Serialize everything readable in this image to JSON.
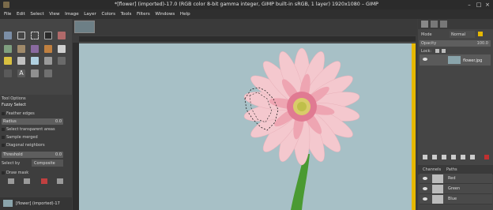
{
  "window": {
    "title": "*[flower] (imported)-17.0 (RGB color 8-bit gamma integer, GIMP built-in sRGB, 1 layer) 1920x1080 – GIMP"
  },
  "menu": [
    "File",
    "Edit",
    "Select",
    "View",
    "Image",
    "Layer",
    "Colors",
    "Tools",
    "Filters",
    "Windows",
    "Help"
  ],
  "tool_options": {
    "tab_label": "Tool Options",
    "tool_name": "Fuzzy Select",
    "feather_edges": "Feather edges",
    "radius_label": "Radius",
    "radius_value": "0.0",
    "select_transparent": "Select transparent areas",
    "sample_merged": "Sample merged",
    "diagonal_neighbors": "Diagonal neighbors",
    "threshold_label": "Threshold",
    "threshold_value": "0.0",
    "select_by_label": "Select by",
    "select_by_value": "Composite",
    "draw_mask": "Draw mask"
  },
  "status": {
    "image_label": "[flower] (imported)-17"
  },
  "layers": {
    "mode_label": "Mode",
    "mode_value": "Normal",
    "opacity_label": "Opacity",
    "opacity_value": "100.0",
    "lock_label": "Lock:",
    "layer_name": "flower.jpg"
  },
  "channels": {
    "tab_channels": "Channels",
    "tab_paths": "Paths",
    "items": [
      "Red",
      "Green",
      "Blue"
    ]
  },
  "colors": {
    "foreground": "#2bd12b",
    "background": "#1aa81a",
    "canvas_bg": "#a7c0c6",
    "accent": "#e6b800"
  }
}
